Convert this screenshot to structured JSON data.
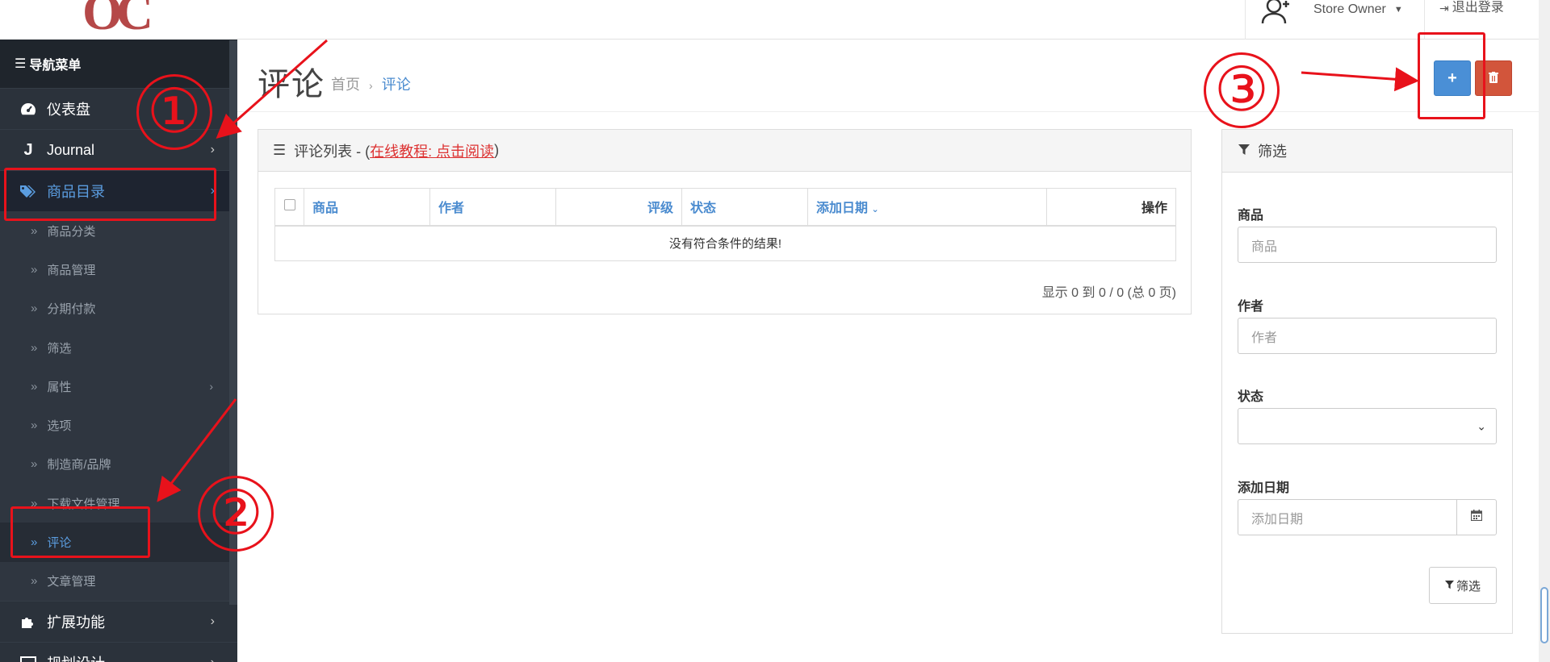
{
  "sidebar": {
    "logo_text": "OC",
    "nav_header": "导航菜单",
    "top_items": [
      {
        "label": "仪表盘",
        "icon": "dashboard-icon"
      },
      {
        "label": "Journal",
        "icon": "journal-icon"
      },
      {
        "label": "商品目录",
        "icon": "tags-icon"
      }
    ],
    "sub_items": [
      {
        "label": "商品分类"
      },
      {
        "label": "商品管理"
      },
      {
        "label": "分期付款"
      },
      {
        "label": "筛选"
      },
      {
        "label": "属性"
      },
      {
        "label": "选项"
      },
      {
        "label": "制造商/品牌"
      },
      {
        "label": "下载文件管理"
      },
      {
        "label": "评论"
      },
      {
        "label": "文章管理"
      }
    ],
    "bottom_items": [
      {
        "label": "扩展功能",
        "icon": "puzzle-icon"
      },
      {
        "label": "规划设计",
        "icon": "desktop-icon"
      }
    ]
  },
  "topbar": {
    "user_name": "Store Owner",
    "logout_label": "退出登录"
  },
  "page": {
    "title": "评论",
    "breadcrumb": [
      "首页",
      "评论"
    ]
  },
  "list": {
    "heading_prefix": "评论列表 - (",
    "tutorial_link": "在线教程: 点击阅读",
    "heading_suffix": ")",
    "columns": {
      "product": "商品",
      "author": "作者",
      "rating": "评级",
      "status": "状态",
      "date_added": "添加日期",
      "action": "操作"
    },
    "empty_text": "没有符合条件的结果!",
    "pagination_text": "显示 0 到 0 / 0 (总 0 页)"
  },
  "filter": {
    "heading": "筛选",
    "product_label": "商品",
    "product_placeholder": "商品",
    "author_label": "作者",
    "author_placeholder": "作者",
    "status_label": "状态",
    "status_value": "",
    "date_label": "添加日期",
    "date_placeholder": "添加日期",
    "button_label": "筛选"
  },
  "annotations": {
    "step1": "①",
    "step2": "②",
    "step3": "③",
    "color": "#e8121b"
  },
  "colors": {
    "sidebar_bg": "#2b323b",
    "accent_blue": "#4a8fd6",
    "danger_red": "#d2553b",
    "link_blue": "#4a8bcf"
  }
}
